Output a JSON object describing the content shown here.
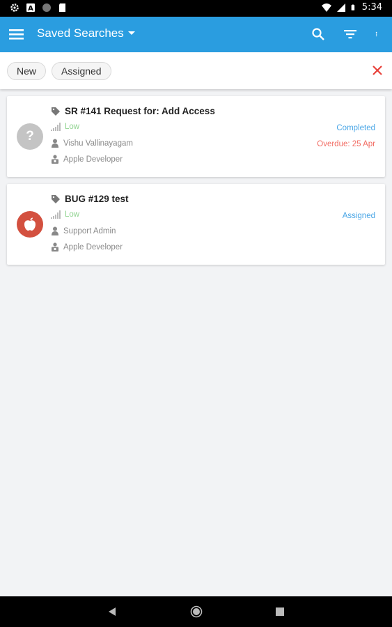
{
  "status_bar": {
    "time": "5:34",
    "icons": [
      "gear-icon",
      "a-icon",
      "circle-icon",
      "sd-card-icon",
      "wifi-icon",
      "signal-icon",
      "battery-icon"
    ]
  },
  "app_bar": {
    "title": "Saved Searches",
    "actions": [
      "search-icon",
      "filter-icon",
      "more-vert-icon"
    ],
    "color": "#2a9de0"
  },
  "filters": {
    "chips": [
      {
        "label": "New"
      },
      {
        "label": "Assigned"
      }
    ],
    "clear_icon": "close-icon"
  },
  "tickets": [
    {
      "title": "SR #141 Request for: Add Access",
      "priority": "Low",
      "assignee": "Vishu Vallinayagam",
      "team": "Apple Developer",
      "status": "Completed",
      "due": "Overdue: 25 Apr",
      "avatar": "?",
      "avatar_icon": "question-icon",
      "avatar_color": "#c4c4c4"
    },
    {
      "title": "BUG #129 test",
      "priority": "Low",
      "assignee": "Support Admin",
      "team": "Apple Developer",
      "status": "Assigned",
      "due": "",
      "avatar": "",
      "avatar_icon": "apple-icon",
      "avatar_color": "#d3503f"
    }
  ],
  "nav_bar": {
    "icons": [
      "back-icon",
      "home-icon",
      "recents-icon"
    ]
  }
}
